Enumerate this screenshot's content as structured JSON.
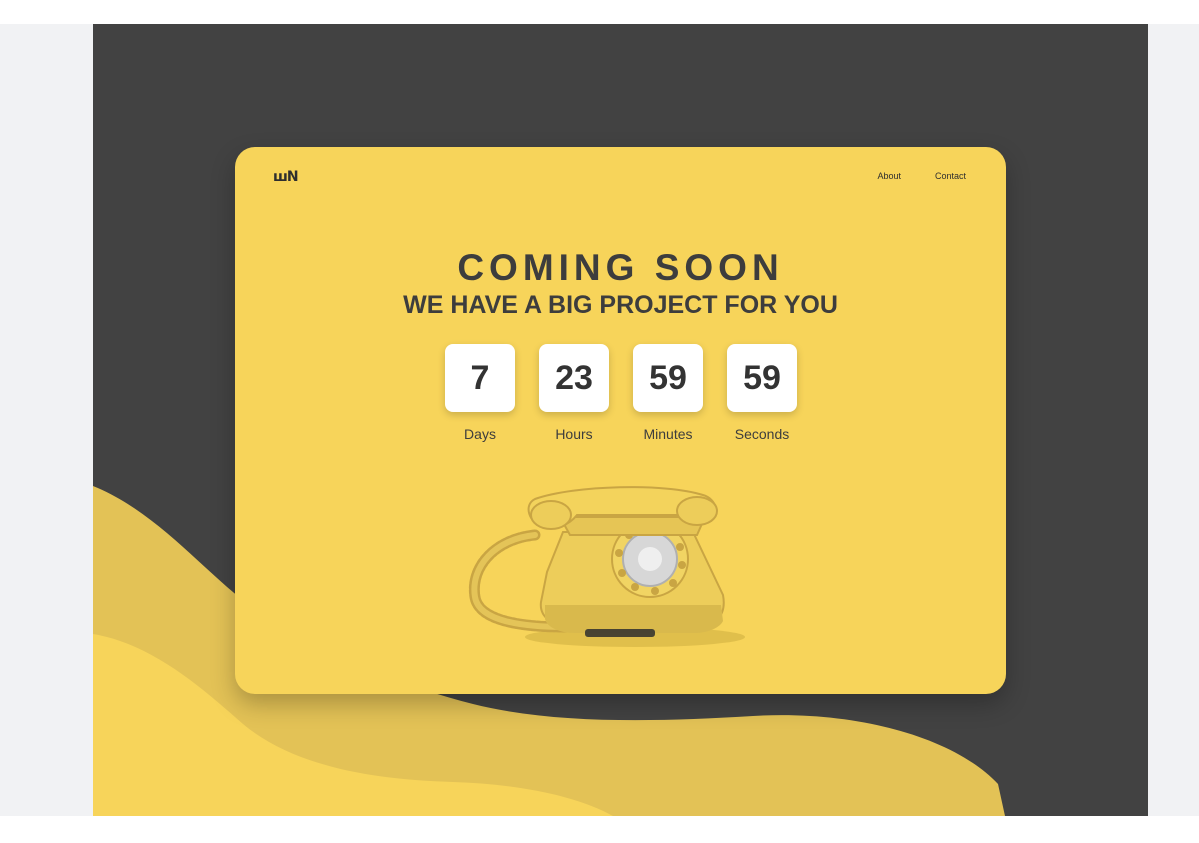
{
  "brand": {
    "logo_text": "ꟺN"
  },
  "nav": {
    "items": [
      {
        "label": "About"
      },
      {
        "label": "Contact"
      }
    ]
  },
  "hero": {
    "title": "COMING SOON",
    "subtitle": "WE HAVE A BIG PROJECT FOR YOU"
  },
  "countdown": {
    "days": {
      "value": "7",
      "label": "Days"
    },
    "hours": {
      "value": "23",
      "label": "Hours"
    },
    "minutes": {
      "value": "59",
      "label": "Minutes"
    },
    "seconds": {
      "value": "59",
      "label": "Seconds"
    }
  },
  "illustration": {
    "icon": "rotary-telephone-icon"
  },
  "colors": {
    "accent_yellow": "#f7d45a",
    "wave_dark_yellow": "#e3c256",
    "background_dark": "#424242",
    "text_dark": "#3d3d3d",
    "side_panel": "#f1f2f4"
  }
}
